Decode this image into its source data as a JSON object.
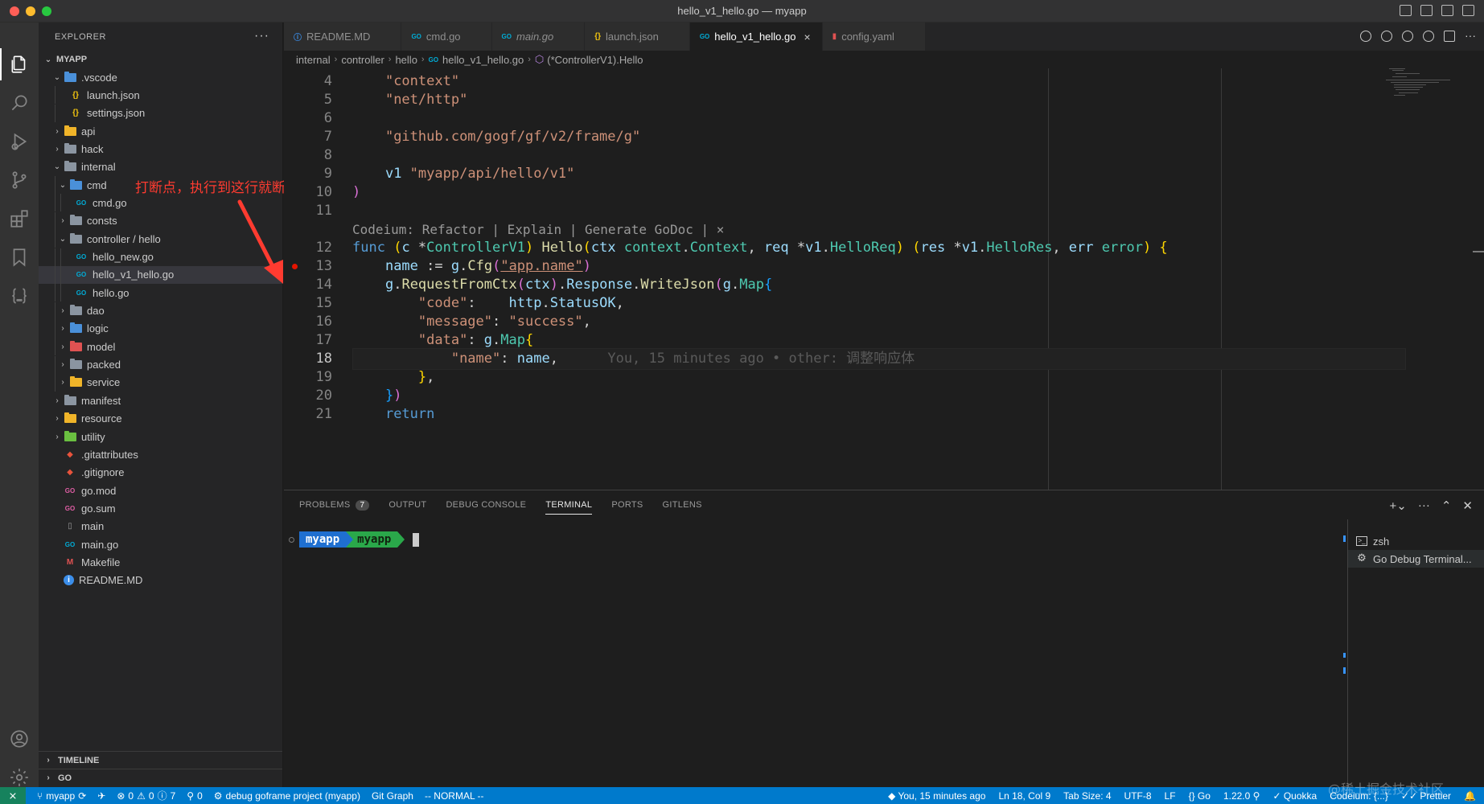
{
  "window": {
    "title": "hello_v1_hello.go — myapp"
  },
  "explorer": {
    "header": "EXPLORER",
    "root": "MYAPP",
    "items": [
      {
        "label": ".vscode",
        "kind": "folder",
        "depth": 1,
        "open": true,
        "color": "#4a90d9"
      },
      {
        "label": "launch.json",
        "kind": "json",
        "depth": 2
      },
      {
        "label": "settings.json",
        "kind": "json",
        "depth": 2
      },
      {
        "label": "api",
        "kind": "folder",
        "depth": 1,
        "open": false,
        "color": "#f0b429"
      },
      {
        "label": "hack",
        "kind": "folder",
        "depth": 1,
        "open": false,
        "color": "#8b95a1"
      },
      {
        "label": "internal",
        "kind": "folder",
        "depth": 1,
        "open": true,
        "color": "#8b95a1"
      },
      {
        "label": "cmd",
        "kind": "folder",
        "depth": 2,
        "open": true,
        "color": "#4a90d9"
      },
      {
        "label": "cmd.go",
        "kind": "go",
        "depth": 3
      },
      {
        "label": "consts",
        "kind": "folder",
        "depth": 2,
        "open": false,
        "color": "#8b95a1"
      },
      {
        "label": "controller / hello",
        "kind": "folder",
        "depth": 2,
        "open": true,
        "color": "#8b95a1"
      },
      {
        "label": "hello_new.go",
        "kind": "go",
        "depth": 3
      },
      {
        "label": "hello_v1_hello.go",
        "kind": "go",
        "depth": 3,
        "selected": true
      },
      {
        "label": "hello.go",
        "kind": "go",
        "depth": 3
      },
      {
        "label": "dao",
        "kind": "folder",
        "depth": 2,
        "open": false,
        "color": "#8b95a1"
      },
      {
        "label": "logic",
        "kind": "folder",
        "depth": 2,
        "open": false,
        "color": "#4a90d9"
      },
      {
        "label": "model",
        "kind": "folder",
        "depth": 2,
        "open": false,
        "color": "#e05252"
      },
      {
        "label": "packed",
        "kind": "folder",
        "depth": 2,
        "open": false,
        "color": "#8b95a1"
      },
      {
        "label": "service",
        "kind": "folder",
        "depth": 2,
        "open": false,
        "color": "#f0b429"
      },
      {
        "label": "manifest",
        "kind": "folder",
        "depth": 1,
        "open": false,
        "color": "#8b95a1"
      },
      {
        "label": "resource",
        "kind": "folder",
        "depth": 1,
        "open": false,
        "color": "#f0b429"
      },
      {
        "label": "utility",
        "kind": "folder",
        "depth": 1,
        "open": false,
        "color": "#6abf40"
      },
      {
        "label": ".gitattributes",
        "kind": "git",
        "depth": 1
      },
      {
        "label": ".gitignore",
        "kind": "git",
        "depth": 1
      },
      {
        "label": "go.mod",
        "kind": "gomod",
        "depth": 1
      },
      {
        "label": "go.sum",
        "kind": "gomod",
        "depth": 1
      },
      {
        "label": "main",
        "kind": "file",
        "depth": 1
      },
      {
        "label": "main.go",
        "kind": "go",
        "depth": 1
      },
      {
        "label": "Makefile",
        "kind": "make",
        "depth": 1
      },
      {
        "label": "README.MD",
        "kind": "info",
        "depth": 1
      }
    ],
    "timeline": "TIMELINE",
    "go": "GO"
  },
  "annotation": {
    "text": "打断点，执行到这行就断住"
  },
  "tabs": [
    {
      "label": "README.MD",
      "icon": "info-icon",
      "color": "#3b8eea",
      "active": false
    },
    {
      "label": "cmd.go",
      "icon": "go-file-icon",
      "color": "#00acd7",
      "active": false
    },
    {
      "label": "main.go",
      "icon": "go-file-icon",
      "color": "#00acd7",
      "active": false,
      "italic": true
    },
    {
      "label": "launch.json",
      "icon": "json-icon",
      "color": "#f1c40f",
      "active": false
    },
    {
      "label": "hello_v1_hello.go",
      "icon": "go-file-icon",
      "color": "#00acd7",
      "active": true
    },
    {
      "label": "config.yaml",
      "icon": "yaml-icon",
      "color": "#e05252",
      "active": false
    }
  ],
  "breadcrumb": [
    "internal",
    "controller",
    "hello",
    "hello_v1_hello.go",
    "(*ControllerV1).Hello"
  ],
  "code": {
    "current_line": 18,
    "breakpoint_line": 13,
    "codelens": "Codeium: Refactor | Explain | Generate GoDoc | ×",
    "blame": "You, 15 minutes ago • other: 调整响应体",
    "lines": [
      {
        "n": 4,
        "tokens": [
          [
            "    ",
            "pun"
          ],
          [
            "\"context\"",
            "str"
          ]
        ]
      },
      {
        "n": 5,
        "tokens": [
          [
            "    ",
            "pun"
          ],
          [
            "\"net/http\"",
            "str"
          ]
        ]
      },
      {
        "n": 6,
        "tokens": []
      },
      {
        "n": 7,
        "tokens": [
          [
            "    ",
            "pun"
          ],
          [
            "\"github.com/gogf/gf/v2/frame/g\"",
            "str"
          ]
        ]
      },
      {
        "n": 8,
        "tokens": []
      },
      {
        "n": 9,
        "tokens": [
          [
            "    ",
            "pun"
          ],
          [
            "v1 ",
            "var"
          ],
          [
            "\"myapp/api/hello/v1\"",
            "str"
          ]
        ]
      },
      {
        "n": 10,
        "tokens": [
          [
            ")",
            "b2"
          ]
        ]
      },
      {
        "n": 11,
        "tokens": []
      },
      {
        "n": 12,
        "tokens": [
          [
            "func ",
            "kw"
          ],
          [
            "(",
            "b1"
          ],
          [
            "c ",
            "var"
          ],
          [
            "*",
            "pun"
          ],
          [
            "ControllerV1",
            "type"
          ],
          [
            ") ",
            "b1"
          ],
          [
            "Hello",
            "fn"
          ],
          [
            "(",
            "b1"
          ],
          [
            "ctx ",
            "var"
          ],
          [
            "context",
            "pkg"
          ],
          [
            ".",
            "pun"
          ],
          [
            "Context",
            "type"
          ],
          [
            ", ",
            "pun"
          ],
          [
            "req ",
            "var"
          ],
          [
            "*",
            "pun"
          ],
          [
            "v1",
            "var"
          ],
          [
            ".",
            "pun"
          ],
          [
            "HelloReq",
            "type"
          ],
          [
            ") ",
            "b1"
          ],
          [
            "(",
            "b1"
          ],
          [
            "res ",
            "var"
          ],
          [
            "*",
            "pun"
          ],
          [
            "v1",
            "var"
          ],
          [
            ".",
            "pun"
          ],
          [
            "HelloRes",
            "type"
          ],
          [
            ", ",
            "pun"
          ],
          [
            "err ",
            "var"
          ],
          [
            "error",
            "type"
          ],
          [
            ") ",
            "b1"
          ],
          [
            "{",
            "b1"
          ]
        ]
      },
      {
        "n": 13,
        "tokens": [
          [
            "    ",
            "pun"
          ],
          [
            "name ",
            "var"
          ],
          [
            ":= ",
            "pun"
          ],
          [
            "g",
            "var"
          ],
          [
            ".",
            "pun"
          ],
          [
            "Cfg",
            "fn"
          ],
          [
            "(",
            "b2"
          ],
          [
            "\"app.name\"",
            "str"
          ],
          [
            ")",
            "b2"
          ]
        ]
      },
      {
        "n": 14,
        "tokens": [
          [
            "    ",
            "pun"
          ],
          [
            "g",
            "var"
          ],
          [
            ".",
            "pun"
          ],
          [
            "RequestFromCtx",
            "fn"
          ],
          [
            "(",
            "b2"
          ],
          [
            "ctx",
            "var"
          ],
          [
            ")",
            "b2"
          ],
          [
            ".",
            "pun"
          ],
          [
            "Response",
            "var"
          ],
          [
            ".",
            "pun"
          ],
          [
            "WriteJson",
            "fn"
          ],
          [
            "(",
            "b2"
          ],
          [
            "g",
            "var"
          ],
          [
            ".",
            "pun"
          ],
          [
            "Map",
            "type"
          ],
          [
            "{",
            "b3"
          ]
        ]
      },
      {
        "n": 15,
        "tokens": [
          [
            "        ",
            "pun"
          ],
          [
            "\"code\"",
            "str"
          ],
          [
            ":    ",
            "pun"
          ],
          [
            "http",
            "var"
          ],
          [
            ".",
            "pun"
          ],
          [
            "StatusOK",
            "var"
          ],
          [
            ",",
            "pun"
          ]
        ]
      },
      {
        "n": 16,
        "tokens": [
          [
            "        ",
            "pun"
          ],
          [
            "\"message\"",
            "str"
          ],
          [
            ": ",
            "pun"
          ],
          [
            "\"success\"",
            "str"
          ],
          [
            ",",
            "pun"
          ]
        ]
      },
      {
        "n": 17,
        "tokens": [
          [
            "        ",
            "pun"
          ],
          [
            "\"data\"",
            "str"
          ],
          [
            ": ",
            "pun"
          ],
          [
            "g",
            "var"
          ],
          [
            ".",
            "pun"
          ],
          [
            "Map",
            "type"
          ],
          [
            "{",
            "b1"
          ]
        ]
      },
      {
        "n": 18,
        "tokens": [
          [
            "            ",
            "pun"
          ],
          [
            "\"name\"",
            "str"
          ],
          [
            ": ",
            "pun"
          ],
          [
            "name",
            "var"
          ],
          [
            ",",
            "pun"
          ]
        ]
      },
      {
        "n": 19,
        "tokens": [
          [
            "        ",
            "pun"
          ],
          [
            "}",
            "b1"
          ],
          [
            ",",
            "pun"
          ]
        ]
      },
      {
        "n": 20,
        "tokens": [
          [
            "    ",
            "pun"
          ],
          [
            "}",
            "b3"
          ],
          [
            ")",
            "b2"
          ]
        ]
      },
      {
        "n": 21,
        "tokens": [
          [
            "    ",
            "pun"
          ],
          [
            "return",
            "kw"
          ]
        ]
      }
    ]
  },
  "panel": {
    "tabs": [
      {
        "label": "PROBLEMS",
        "badge": "7",
        "active": false
      },
      {
        "label": "OUTPUT",
        "active": false
      },
      {
        "label": "DEBUG CONSOLE",
        "active": false
      },
      {
        "label": "TERMINAL",
        "active": true
      },
      {
        "label": "PORTS",
        "active": false
      },
      {
        "label": "GITLENS",
        "active": false
      }
    ],
    "prompt_segment1": "myapp",
    "prompt_segment2": " myapp",
    "terminals": [
      {
        "label": "zsh",
        "icon": "terminal-icon"
      },
      {
        "label": "Go Debug Terminal...",
        "icon": "debug-gear-icon",
        "selected": true
      }
    ]
  },
  "status": {
    "branch": "myapp",
    "problems_errors": "0",
    "problems_warnings": "0",
    "problems_info": "7",
    "ports": "0",
    "debug_config": "debug goframe project (myapp)",
    "git_graph": "Git Graph",
    "vim_mode": "-- NORMAL --",
    "blame": "You, 15 minutes ago",
    "cursor_pos": "Ln 18, Col 9",
    "tab_size": "Tab Size: 4",
    "encoding": "UTF-8",
    "eol": "LF",
    "language": "Go",
    "go_version": "1.22.0",
    "quokka": "Quokka",
    "codeium": "Codeium: {...}",
    "prettier": "Prettier"
  },
  "watermark": "@稀土掘金技术社区"
}
